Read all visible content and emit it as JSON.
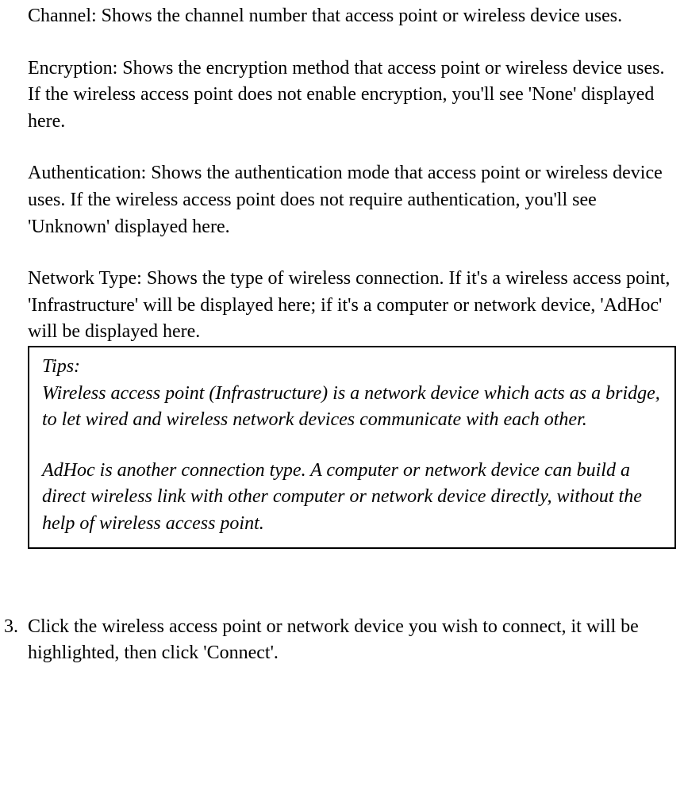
{
  "body": {
    "channel": "Channel: Shows the channel number that access point or wireless device uses.",
    "encryption": "Encryption: Shows the encryption method that access point or wireless device uses. If the wireless access point does not enable encryption, you'll see 'None' displayed here.",
    "authentication": "Authentication: Shows the authentication mode that access point or wireless device uses. If the wireless access point does not require authentication, you'll see 'Unknown' displayed here.",
    "network_type": "Network Type: Shows the type of wireless connection. If it's a wireless access point, 'Infrastructure' will be displayed here; if it's a computer or network device, 'AdHoc' will be displayed here."
  },
  "tips": {
    "heading": "Tips:",
    "infra": "Wireless access point (Infrastructure) is a network device which acts as a bridge, to let wired and wireless network devices communicate with each other.",
    "adhoc": "AdHoc is another connection type. A computer or network device can build a direct wireless link with other computer or network device directly, without the help of wireless access point."
  },
  "step3": {
    "num": "3.",
    "text": "Click the wireless access point or network device you wish to connect, it will be highlighted, then click 'Connect'."
  }
}
